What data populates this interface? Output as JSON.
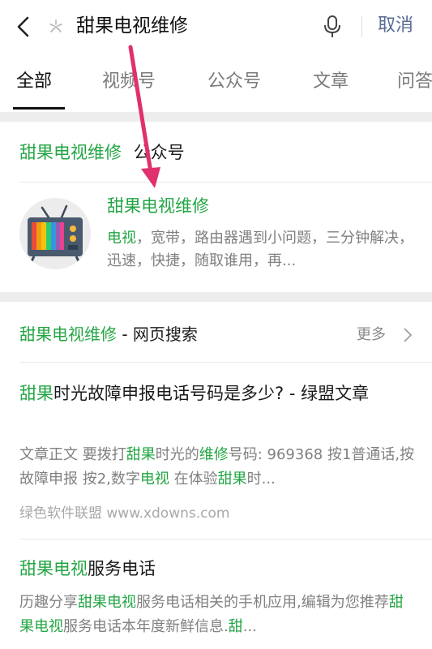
{
  "search": {
    "query": "甜果电视维修",
    "cancel_label": "取消"
  },
  "tabs": [
    "全部",
    "视频号",
    "公众号",
    "文章",
    "问答"
  ],
  "account_section": {
    "title_highlight": "甜果电视维修",
    "title_suffix": "公众号",
    "name": "甜果电视维修",
    "desc_highlight": "电视",
    "desc_text": "，宽带，路由器遇到小问题，三分钟解决，迅速，快捷，随取谁用，再..."
  },
  "web_section": {
    "title_highlight": "甜果电视维修",
    "title_suffix": " - 网页搜索",
    "more_label": "更多"
  },
  "results": [
    {
      "title_hl": "甜果",
      "title_rest": "时光故障申报电话号码是多少? - 绿盟文章",
      "snippet": [
        {
          "t": "文章正文 要拨打",
          "hl": false
        },
        {
          "t": "甜果",
          "hl": true
        },
        {
          "t": "时光的",
          "hl": false
        },
        {
          "t": "维修",
          "hl": true
        },
        {
          "t": "号码: 969368 按1普通话,按故障申报 按2,数字",
          "hl": false
        },
        {
          "t": "电视",
          "hl": true
        },
        {
          "t": " 在体验",
          "hl": false
        },
        {
          "t": "甜果",
          "hl": true
        },
        {
          "t": "时...",
          "hl": false
        }
      ],
      "source": "绿色软件联盟 www.xdowns.com"
    },
    {
      "title_hl": "甜果电视",
      "title_rest": "服务电话",
      "snippet": [
        {
          "t": "历趣分享",
          "hl": false
        },
        {
          "t": "甜果电视",
          "hl": true
        },
        {
          "t": "服务电话相关的手机应用,编辑为您推荐",
          "hl": false
        },
        {
          "t": "甜果电视",
          "hl": true
        },
        {
          "t": "服务电话本年度新鲜信息.",
          "hl": false
        },
        {
          "t": "甜",
          "hl": true
        },
        {
          "t": "...",
          "hl": false
        }
      ]
    }
  ],
  "colors": {
    "accent_green": "#23a644",
    "link_blue": "#576b95",
    "annotation_arrow": "#e0306e"
  }
}
